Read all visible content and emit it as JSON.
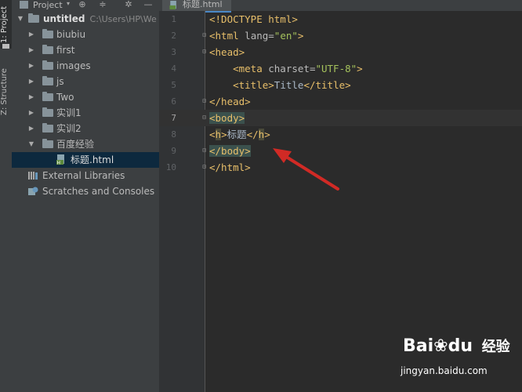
{
  "left_strip": {
    "project_tab": "1: Project",
    "structure_tab": "Z: Structure"
  },
  "project_panel": {
    "title": "Project",
    "header_icons": [
      "target-icon",
      "collapse-icon",
      "gear-icon",
      "minimize-icon"
    ]
  },
  "tree": {
    "root": {
      "label": "untitled",
      "path": "C:\\Users\\HP\\We"
    },
    "folders": [
      "biubiu",
      "first",
      "images",
      "js",
      "Two",
      "实训1",
      "实训2",
      "百度经验"
    ],
    "file": "标题.html",
    "external_libraries": "External Libraries",
    "scratches": "Scratches and Consoles"
  },
  "editor": {
    "tab_label": "标题.html",
    "line_numbers": [
      "1",
      "2",
      "3",
      "4",
      "5",
      "6",
      "7",
      "8",
      "9",
      "10"
    ],
    "lines": {
      "l1": "<!DOCTYPE html>",
      "l2_open": "<html",
      "l2_attr": " lang=",
      "l2_val": "\"en\"",
      "l2_close": ">",
      "l3": "<head>",
      "l4_open": "    <meta",
      "l4_attr": " charset=",
      "l4_val": "\"UTF-8\"",
      "l4_close": ">",
      "l5_open": "    <title>",
      "l5_text": "Title",
      "l5_close": "</title>",
      "l6": "</head>",
      "l7": "<body>",
      "l8_open_a": "<",
      "l8_open_b": "h",
      "l8_open_c": ">",
      "l8_text": "标题",
      "l8_close_a": "</",
      "l8_close_b": "h",
      "l8_close_c": ">",
      "l9": "</body>",
      "l10": "</html>"
    }
  },
  "watermark": {
    "logo_text_a": "Bai",
    "logo_text_b": "du",
    "logo_text_c": "经验",
    "url": "jingyan.baidu.com"
  },
  "colors": {
    "background": "#2b2b2b",
    "panel": "#3c3f41",
    "selection": "#0d293e",
    "tag": "#e8bf6a",
    "string": "#a5c25c",
    "annotation_arrow": "#d12a25"
  }
}
